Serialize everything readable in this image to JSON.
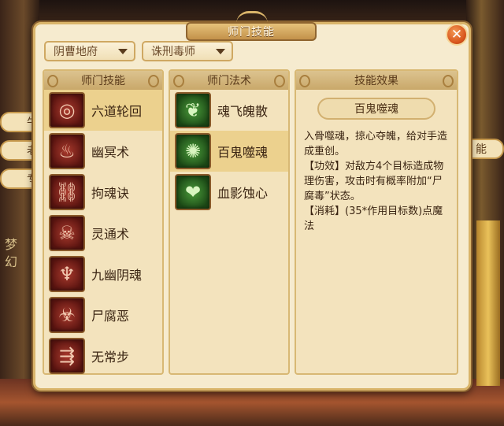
{
  "dialog": {
    "title": "师门技能",
    "close_label": "✕"
  },
  "filters": {
    "sect": "阴曹地府",
    "role": "诛刑毒师"
  },
  "columns": {
    "skills_header": "师门技能",
    "spells_header": "师门法术",
    "effect_header": "技能效果"
  },
  "skills": [
    {
      "label": "六道轮回",
      "icon": "ring-icon",
      "glyph": "◎",
      "selected": true
    },
    {
      "label": "幽冥术",
      "icon": "ghost-icon",
      "glyph": "♨",
      "selected": false
    },
    {
      "label": "拘魂诀",
      "icon": "cage-icon",
      "glyph": "⛓",
      "selected": false
    },
    {
      "label": "灵通术",
      "icon": "skull-icon",
      "glyph": "☠",
      "selected": false
    },
    {
      "label": "九幽阴魂",
      "icon": "spirits-icon",
      "glyph": "♆",
      "selected": false
    },
    {
      "label": "尸腐恶",
      "icon": "rot-icon",
      "glyph": "☣",
      "selected": false
    },
    {
      "label": "无常步",
      "icon": "footstep-icon",
      "glyph": "⇶",
      "selected": false
    }
  ],
  "spells": [
    {
      "label": "魂飞魄散",
      "icon": "soul-icon",
      "glyph": "❦",
      "selected": false
    },
    {
      "label": "百鬼噬魂",
      "icon": "ghosts-icon",
      "glyph": "✺",
      "selected": true
    },
    {
      "label": "血影蚀心",
      "icon": "heart-icon",
      "glyph": "❤",
      "selected": false
    }
  ],
  "effect": {
    "name": "百鬼噬魂",
    "lines": [
      "入骨噬魂，掠心夺魄，给对手造成重创。",
      "【功效】对敌方4个目标造成物理伤害，攻击时有概率附加“尸腐毒”状态。",
      "【消耗】(35*作用目标数)点魔法"
    ]
  },
  "background": {
    "side_tabs": [
      "牛",
      "老",
      "专",
      "能"
    ],
    "mural_text": "梦幻"
  },
  "colors": {
    "panel_bg": "#f6ebcf",
    "border_gold": "#d9b46a",
    "selected_row": "#ecd18e",
    "close_orange": "#d8541c"
  }
}
